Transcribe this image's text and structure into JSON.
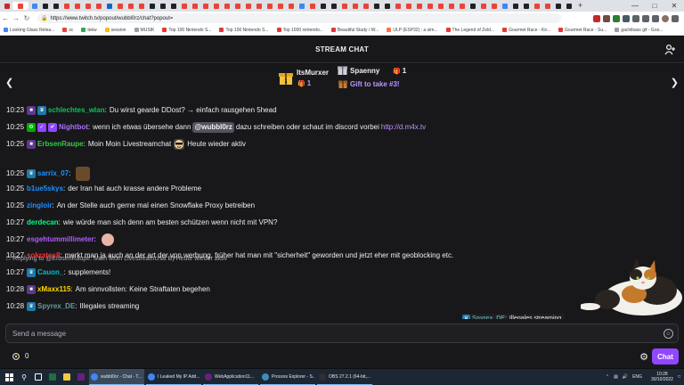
{
  "browser": {
    "url": "https://www.twitch.tv/popout/wubbl0rz/chat?popout=",
    "bookmarks": [
      {
        "label": "Looking Glass Relea...",
        "color": "#4285f4"
      },
      {
        "label": "sc",
        "color": "#ea4335"
      },
      {
        "label": "tekw",
        "color": "#34a853"
      },
      {
        "label": "session",
        "color": "#fbbc04"
      },
      {
        "label": "MUSIK",
        "color": "#9aa0a6"
      },
      {
        "label": "Top 100 Nintendo S...",
        "color": "#e53935"
      },
      {
        "label": "Top 100 Nintendo S...",
        "color": "#e53935"
      },
      {
        "label": "Top 1000 nintendo...",
        "color": "#e53935"
      },
      {
        "label": "Beautiful Study / W...",
        "color": "#e53935"
      },
      {
        "label": "ULP (ESP32) : a sim...",
        "color": "#ff7043"
      },
      {
        "label": "The Legend of Zeld...",
        "color": "#e53935"
      },
      {
        "label": "Gourmet Race - Kir...",
        "color": "#e53935"
      },
      {
        "label": "Gourmet Race - Su...",
        "color": "#e53935"
      },
      {
        "label": "gachibass gif - Goo...",
        "color": "#9e9e9e"
      }
    ]
  },
  "chat": {
    "header_title": "STREAM CHAT",
    "leaderboard": {
      "gifter1_name": "ItsMurxer",
      "gifter1_count": "1",
      "gifter2_name": "Spaenny",
      "gifter2_count": "1",
      "gift_cta": "Gift to take #3!"
    },
    "messages": [
      {
        "time": "10:23",
        "user": "schlechtes_wlan",
        "color": "#00c957",
        "text": "Du wirst gearde DDost? → einfach rausgehen 5head"
      },
      {
        "time": "10:25",
        "user": "Nightbot",
        "color": "#a970ff",
        "text_before": "wenn ich etwas übersehe dann",
        "mention": "@wubbl0rz",
        "text_after": "dazu schreiben oder schaut im discord vorbei",
        "link": "http://d.m4x.tv"
      },
      {
        "time": "10:25",
        "user": "ErbsenRaupe",
        "color": "#2ecc40",
        "text": "Moin Moin Livestreamchat"
      },
      {
        "time": "10:25",
        "user": "sarrix_07",
        "color": "#1e90ff",
        "text": ""
      },
      {
        "time": "10:25",
        "user": "b1ue5skys",
        "color": "#1e90ff",
        "text": "der Iran hat auch krasse andere Probleme"
      },
      {
        "time": "10:25",
        "user": "zingloir",
        "color": "#1e90ff",
        "text": "An der Stelle auch gerne mal einen Snowflake Proxy betreiben"
      },
      {
        "time": "10:27",
        "user": "derdecan",
        "color": "#00ff7f",
        "text": "wie würde man sich denn am besten schützen wenn nicht mit VPN?"
      },
      {
        "time": "10:27",
        "user": "esgehtummillimeter",
        "color": "#b05cff",
        "text": ""
      },
      {
        "time": "10:27",
        "user": "sokrates8",
        "color": "#ff2f2f",
        "text": "merkt man ja auch an der art der vpn werbung. früher hat man mit \"sicherheit\" geworden und jetzt eher mit geoblocking etc."
      },
      {
        "time": "10:27",
        "user": "Cauon_",
        "color": "#00bfbf",
        "text": "supplements!"
      },
      {
        "time": "10:28",
        "user": "xMaxx115",
        "color": "#ffd700",
        "text": "Am sinnvollsten: Keine Straftaten begehen"
      },
      {
        "time": "10:28",
        "user": "Spyrex_DE",
        "color": "#5f9ea0",
        "text": "Illegales streaming"
      }
    ],
    "reply_text": "Replying to @ErbsenRaupe: Moin Moin Livestreamchat B) Heute wieder aktiv",
    "erbsen_tail": "Heute wieder aktiv",
    "overlay_chip": {
      "user": "Spyrex_DE",
      "text": "Illegales streaming"
    },
    "input_placeholder": "Send a message",
    "points": "0",
    "chat_button": "Chat"
  },
  "taskbar": {
    "apps": [
      {
        "label": "wubbl0rz - Chat - T...",
        "color": "#4285f4",
        "active": true
      },
      {
        "label": "I Leaked My IP Add...",
        "color": "#4285f4",
        "active": false
      },
      {
        "label": "WebApplication11...",
        "color": "#68217a",
        "active": false
      },
      {
        "label": "Process Explorer - S...",
        "color": "#3c8dbc",
        "active": false
      },
      {
        "label": "OBS 27.2.1 (64-bit,...",
        "color": "#302e31",
        "active": false
      }
    ],
    "lang": "ENG",
    "time": "10:28",
    "date": "30/10/2022"
  },
  "colors": {
    "twitch_purple": "#9147ff",
    "chat_bg": "#18181b"
  }
}
